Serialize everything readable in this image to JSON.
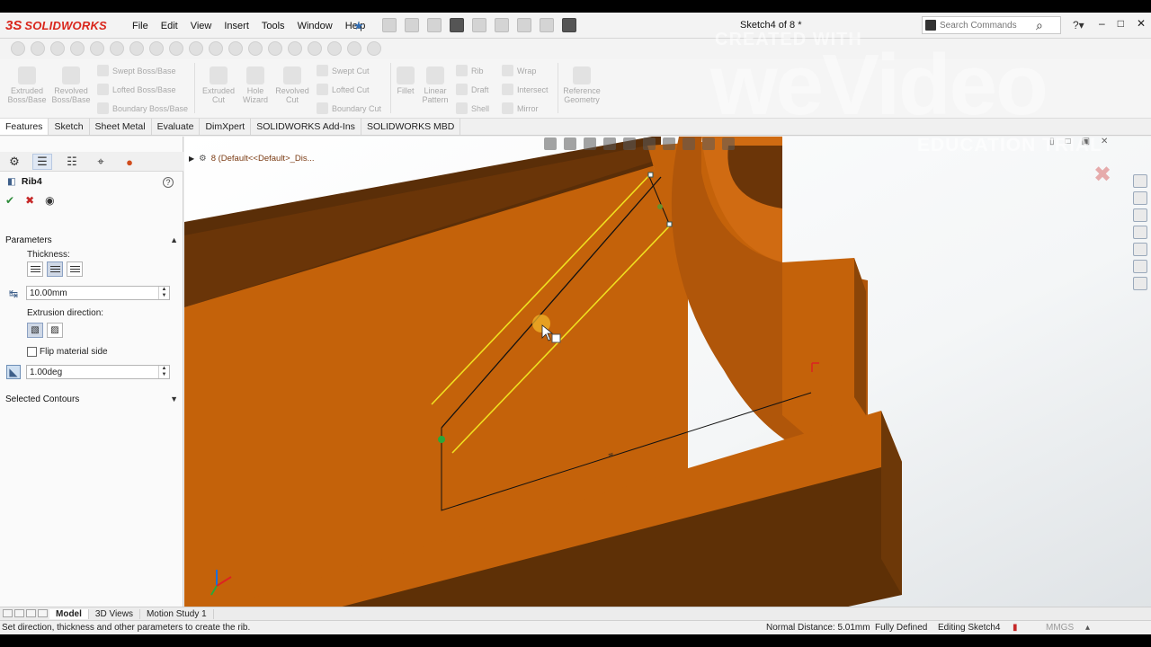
{
  "app": {
    "brand": "SOLIDWORKS",
    "doc_title": "Sketch4 of 8 *"
  },
  "menu": [
    "File",
    "Edit",
    "View",
    "Insert",
    "Tools",
    "Window",
    "Help"
  ],
  "search": {
    "placeholder": "Search Commands"
  },
  "command_manager": {
    "extruded_boss": "Extruded\nBoss/Base",
    "revolved_boss": "Revolved\nBoss/Base",
    "swept_boss": "Swept Boss/Base",
    "lofted_boss": "Lofted Boss/Base",
    "boundary_boss": "Boundary Boss/Base",
    "extruded_cut": "Extruded\nCut",
    "hole_wizard": "Hole\nWizard",
    "revolved_cut": "Revolved\nCut",
    "swept_cut": "Swept Cut",
    "lofted_cut": "Lofted Cut",
    "boundary_cut": "Boundary Cut",
    "fillet": "Fillet",
    "linear_pattern": "Linear\nPattern",
    "rib": "Rib",
    "draft": "Draft",
    "shell": "Shell",
    "wrap": "Wrap",
    "intersect": "Intersect",
    "mirror": "Mirror",
    "reference_geometry": "Reference\nGeometry"
  },
  "tabs": [
    "Features",
    "Sketch",
    "Sheet Metal",
    "Evaluate",
    "DimXpert",
    "SOLIDWORKS Add-Ins",
    "SOLIDWORKS MBD"
  ],
  "property_manager": {
    "title": "Rib4",
    "parameters_label": "Parameters",
    "thickness_label": "Thickness:",
    "thickness_value": "10.00mm",
    "extrusion_label": "Extrusion direction:",
    "flip_label": "Flip material side",
    "draft_value": "1.00deg",
    "selected_contours_label": "Selected Contours"
  },
  "viewport": {
    "tree_item": "8  (Default<<Default>_Dis...",
    "model_color": "#c4620a",
    "sketch_color": "#f0e020"
  },
  "watermark": {
    "created_with": "CREATED WITH",
    "brand": "weVideo",
    "edu": "EDUCATION TRIAL"
  },
  "bottom_tabs": [
    "Model",
    "3D Views",
    "Motion Study 1"
  ],
  "status": {
    "message": "Set direction, thickness and other parameters to create the rib.",
    "normal_distance": "Normal Distance: 5.01mm",
    "defined": "Fully Defined",
    "editing": "Editing Sketch4",
    "units": "MMGS"
  }
}
